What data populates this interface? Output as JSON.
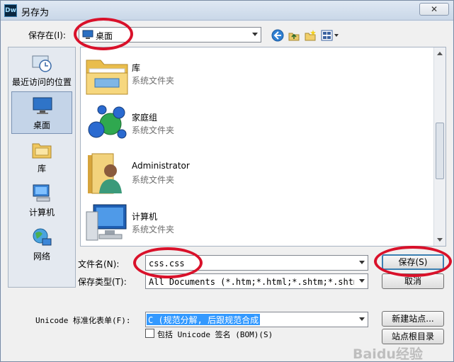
{
  "window": {
    "title": "另存为",
    "app_icon_text": "Dw",
    "close_glyph": "✕"
  },
  "location_bar": {
    "label": "保存在(I):",
    "selected": "桌面"
  },
  "places": [
    {
      "label": "最近访问的位置",
      "icon": "recent-places-icon"
    },
    {
      "label": "桌面",
      "icon": "desktop-icon",
      "selected": true
    },
    {
      "label": "库",
      "icon": "library-icon"
    },
    {
      "label": "计算机",
      "icon": "computer-icon"
    },
    {
      "label": "网络",
      "icon": "network-icon"
    }
  ],
  "files": [
    {
      "name": "库",
      "type": "系统文件夹",
      "icon": "library-folder-icon"
    },
    {
      "name": "家庭组",
      "type": "系统文件夹",
      "icon": "homegroup-icon"
    },
    {
      "name": "Administrator",
      "type": "系统文件夹",
      "icon": "user-folder-icon"
    },
    {
      "name": "计算机",
      "type": "系统文件夹",
      "icon": "computer-icon"
    }
  ],
  "filename": {
    "label": "文件名(N):",
    "value": "css.css"
  },
  "filetype": {
    "label": "保存类型(T):",
    "value": "All Documents (*.htm;*.html;*.shtm;*.shtml;*.hta;"
  },
  "unicode": {
    "label": "Unicode 标准化表单(F):",
    "value": "C (规范分解, 后跟规范合成)"
  },
  "bom_checkbox": {
    "label": "包括 Unicode 签名 (BOM)(S)",
    "checked": false
  },
  "buttons": {
    "save": "保存(S)",
    "cancel": "取消",
    "new_site": "新建站点...",
    "site_root": "站点根目录"
  },
  "watermark": "Baidu经验",
  "colors": {
    "annotation_red": "#d9112a",
    "selection_blue": "#3399ff"
  }
}
